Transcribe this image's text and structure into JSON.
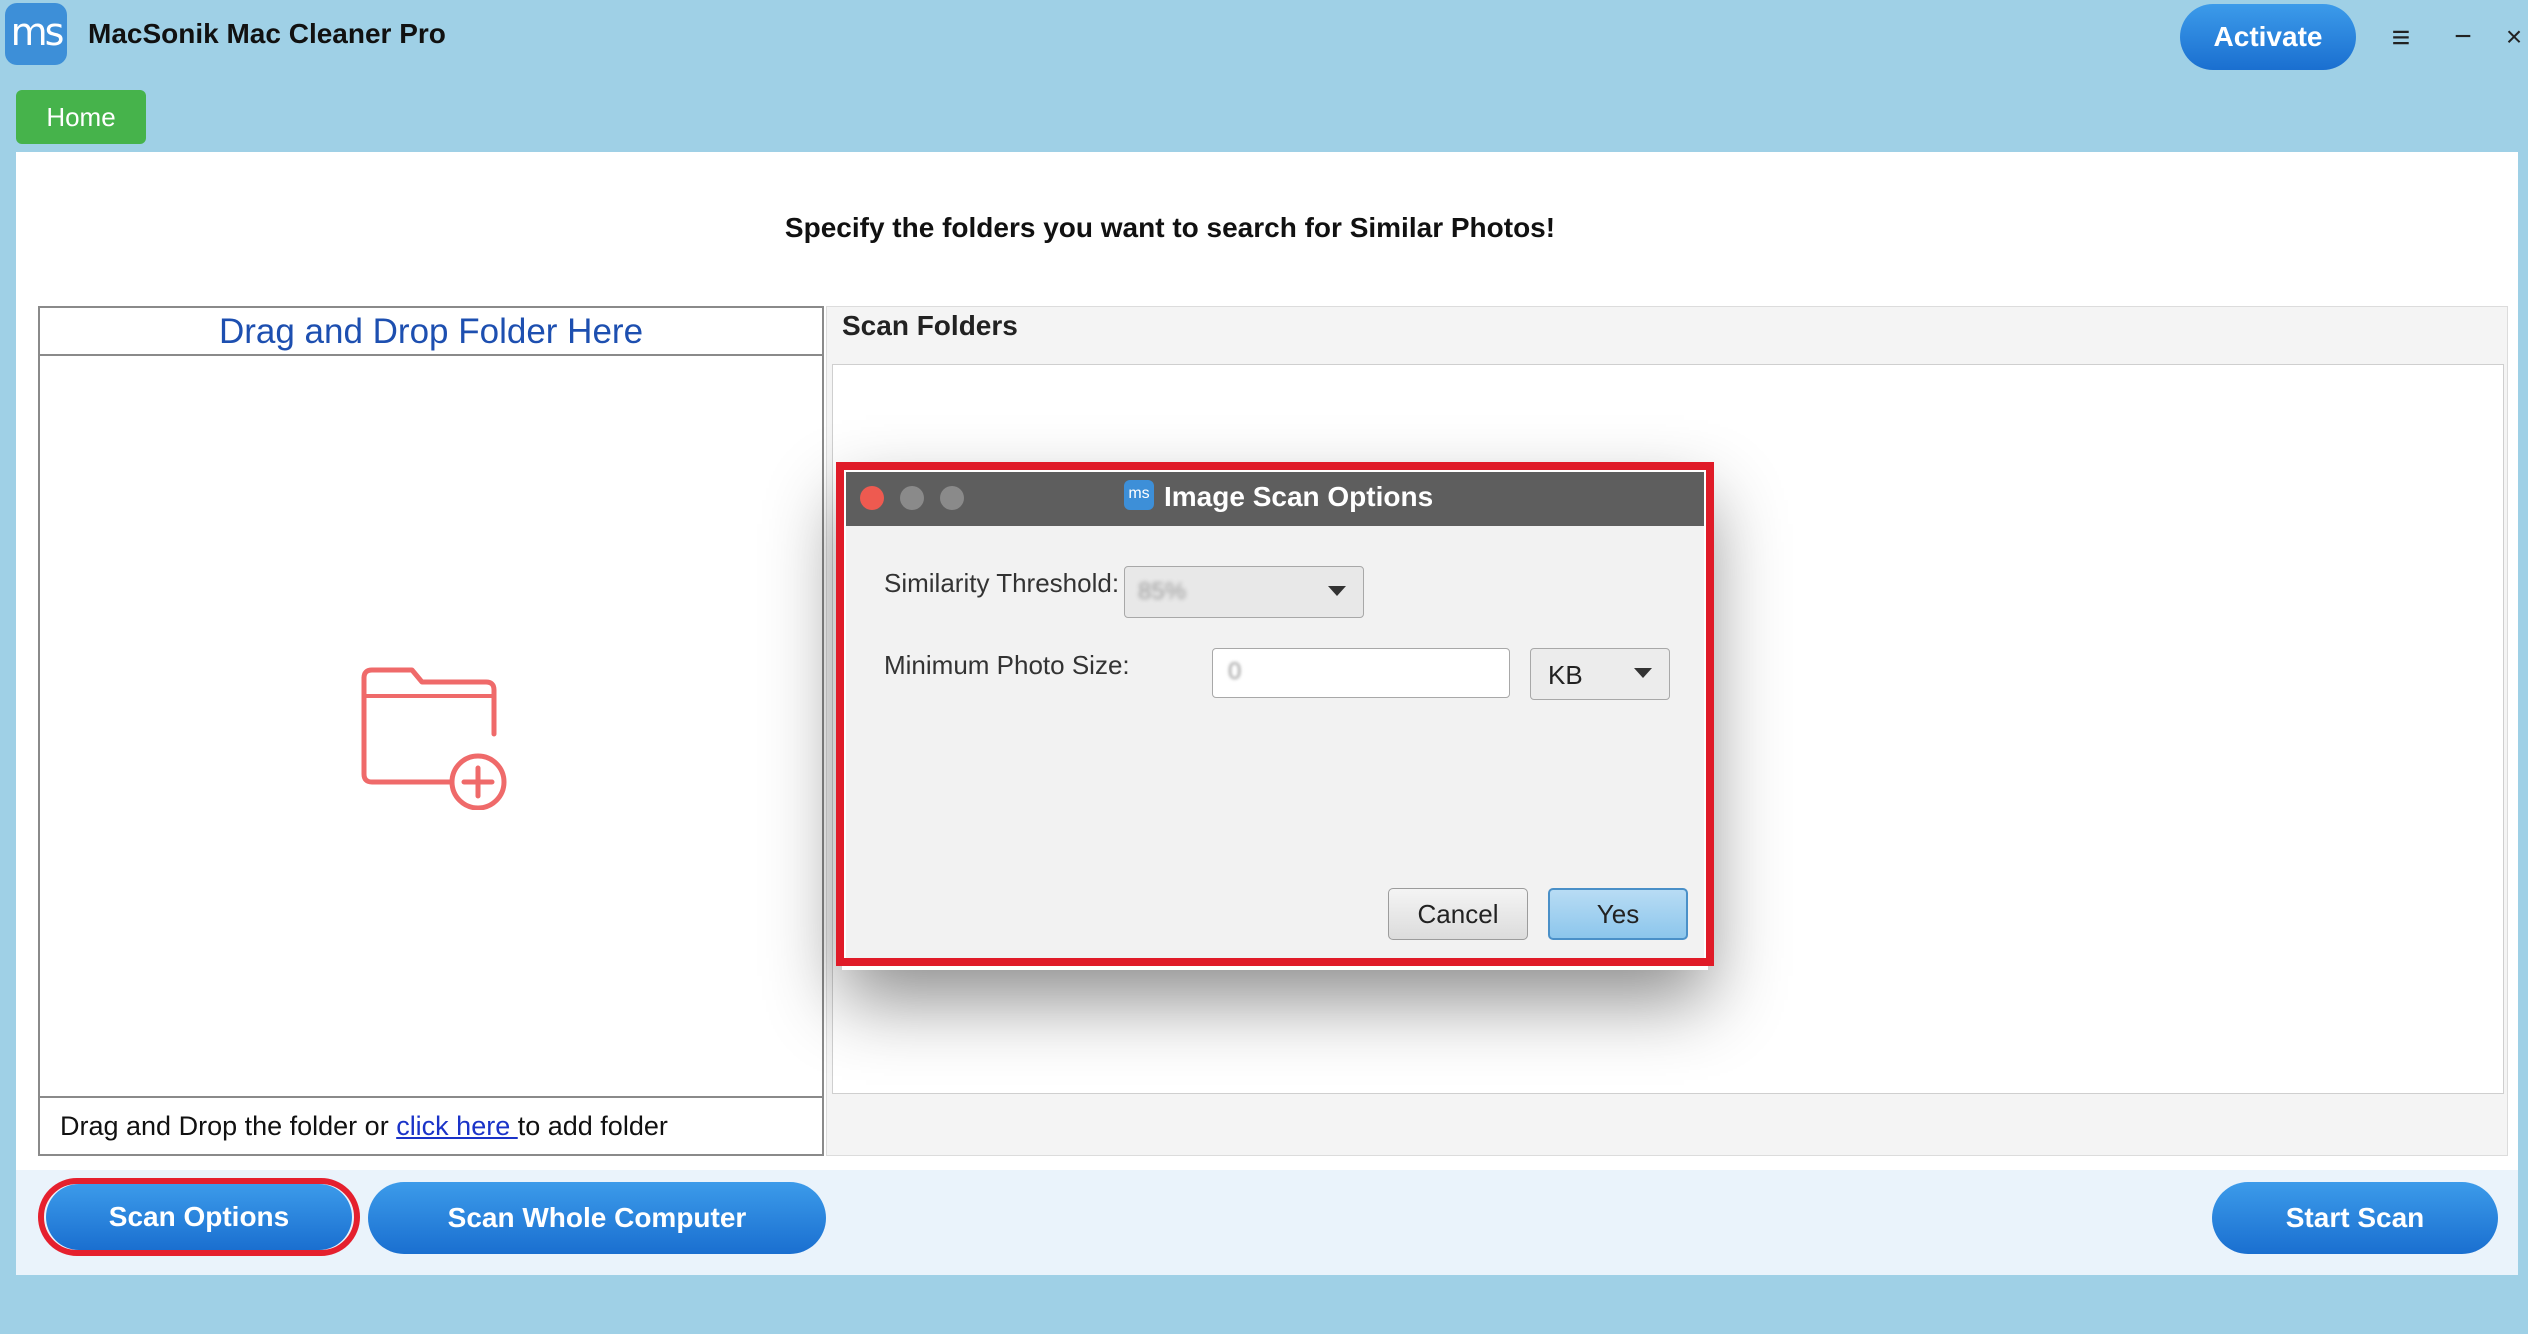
{
  "app": {
    "title": "MacSonik Mac Cleaner Pro",
    "logo_text": "ms",
    "activate_label": "Activate"
  },
  "window_controls": {
    "menu": "≡",
    "minimize": "−",
    "close": "×"
  },
  "nav": {
    "home_label": "Home"
  },
  "heading": "Specify the folders you want to search for  Similar Photos!",
  "drop_panel": {
    "header": "Drag and Drop Folder Here",
    "footer_prefix": "Drag and Drop the folder or ",
    "footer_link": " click here ",
    "footer_suffix": " to add folder"
  },
  "scan_folders": {
    "title": "Scan Folders"
  },
  "buttons": {
    "scan_options": "Scan Options",
    "scan_whole": "Scan Whole Computer",
    "start_scan": "Start Scan"
  },
  "dialog": {
    "title": "Image Scan Options",
    "logo_text": "ms",
    "similarity_label": "Similarity Threshold:",
    "similarity_value": "85%",
    "min_size_label": "Minimum Photo Size:",
    "min_size_value": "0",
    "unit_value": "KB",
    "cancel_label": "Cancel",
    "yes_label": "Yes"
  },
  "colors": {
    "background": "#9fd0e6",
    "accent_blue": "#1a6fd0",
    "home_green": "#46b34b",
    "highlight_red": "#e01b28",
    "folder_icon": "#ef6a6a"
  }
}
